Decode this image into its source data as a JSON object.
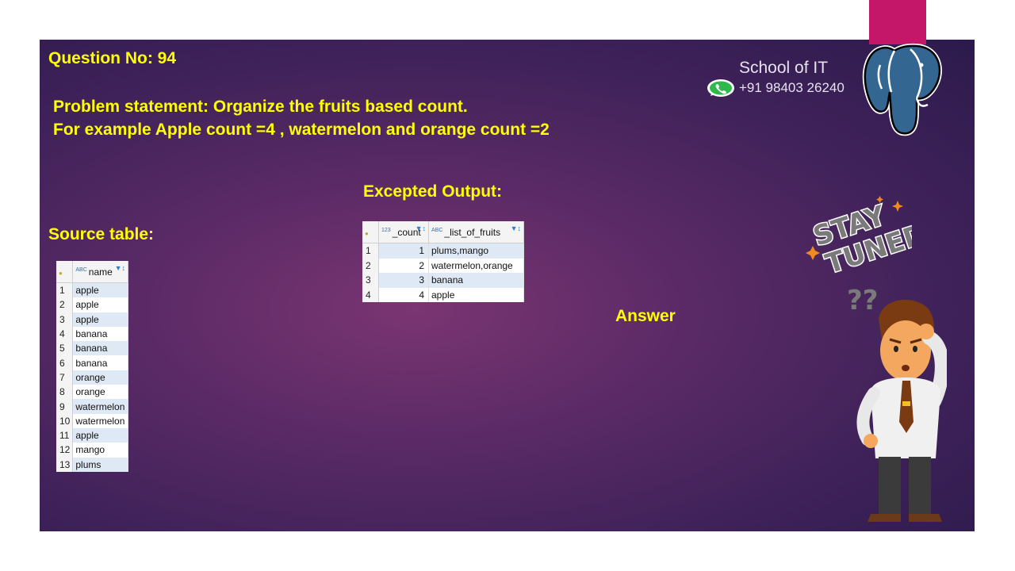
{
  "header": {
    "question": "Question No: 94",
    "problem_line1": "Problem statement: Organize the fruits based count.",
    "problem_line2": "For example Apple count =4 , watermelon and orange count =2",
    "expected_title": "Excepted Output:",
    "source_title": "Source table:",
    "answer": "Answer"
  },
  "brand": {
    "name": "School of IT",
    "phone": "+91 98403 26240",
    "whatsapp_icon": "whatsapp-icon",
    "logo_icon": "postgresql-elephant-icon"
  },
  "source_table": {
    "column": "name",
    "rows": [
      {
        "n": "1",
        "name": "apple"
      },
      {
        "n": "2",
        "name": "apple"
      },
      {
        "n": "3",
        "name": "apple"
      },
      {
        "n": "4",
        "name": "banana"
      },
      {
        "n": "5",
        "name": "banana"
      },
      {
        "n": "6",
        "name": "banana"
      },
      {
        "n": "7",
        "name": "orange"
      },
      {
        "n": "8",
        "name": "orange"
      },
      {
        "n": "9",
        "name": "watermelon"
      },
      {
        "n": "10",
        "name": "watermelon"
      },
      {
        "n": "11",
        "name": "apple"
      },
      {
        "n": "12",
        "name": "mango"
      },
      {
        "n": "13",
        "name": "plums"
      }
    ]
  },
  "output_table": {
    "columns": [
      "_count",
      "_list_of_fruits"
    ],
    "rows": [
      {
        "n": "1",
        "count": "1",
        "fruits": "plums,mango"
      },
      {
        "n": "2",
        "count": "2",
        "fruits": "watermelon,orange"
      },
      {
        "n": "3",
        "count": "3",
        "fruits": "banana"
      },
      {
        "n": "4",
        "count": "4",
        "fruits": "apple"
      }
    ]
  },
  "type_tags": {
    "text": "ABC",
    "number": "123"
  },
  "sticker": {
    "line1": "STAY",
    "line2": "TUNED",
    "question_marks": "??"
  },
  "colors": {
    "accent_yellow": "#ffff00",
    "brand_pink": "#c4176a",
    "row_alt": "#dfe8f5"
  }
}
